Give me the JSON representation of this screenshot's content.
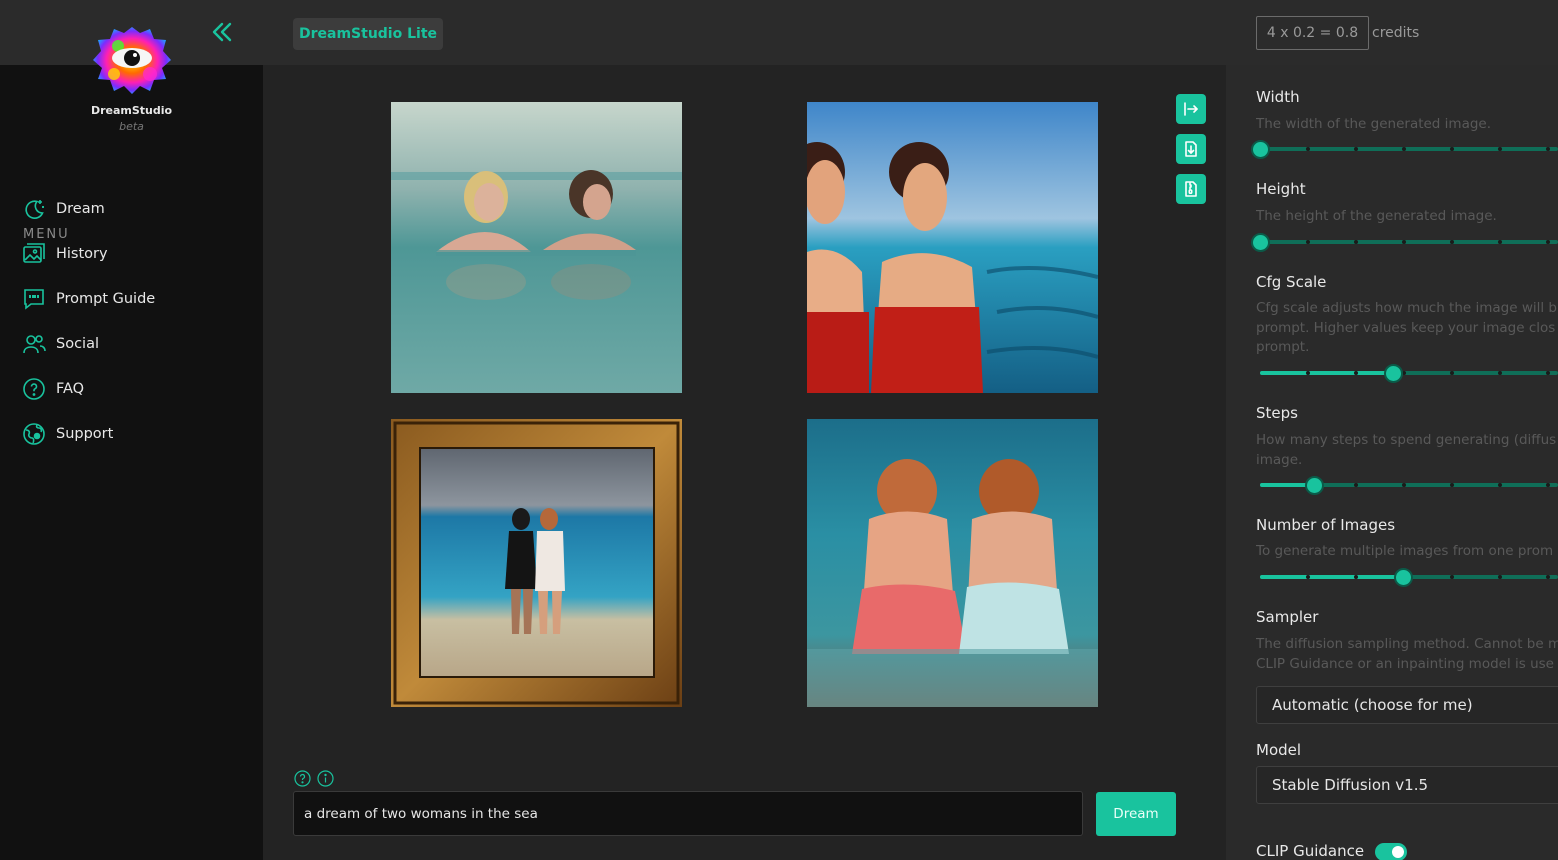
{
  "app": {
    "name": "DreamStudio",
    "beta_label": "beta",
    "mode_tab": "DreamStudio Lite",
    "credits_calc": "4 x 0.2 = 0.8",
    "credits_label": "credits"
  },
  "menu": {
    "heading": "MENU",
    "items": [
      {
        "label": "Dream",
        "icon": "moon-stars-icon"
      },
      {
        "label": "History",
        "icon": "gallery-icon"
      },
      {
        "label": "Prompt Guide",
        "icon": "chat-quote-icon"
      },
      {
        "label": "Social",
        "icon": "users-icon"
      },
      {
        "label": "FAQ",
        "icon": "question-circle-icon"
      },
      {
        "label": "Support",
        "icon": "globe-support-icon"
      }
    ]
  },
  "gallery": {
    "images": [
      {
        "description_icon": "image-two-women-in-sea"
      },
      {
        "description_icon": "image-painted-women-red-dresses"
      },
      {
        "description_icon": "image-framed-women-on-beach"
      },
      {
        "description_icon": "image-women-sitting-in-water"
      }
    ],
    "actions": [
      "use-as-init-icon",
      "download-icon",
      "download-zip-icon"
    ]
  },
  "prompt": {
    "value": "a dream of two womans in the sea",
    "dream_button": "Dream"
  },
  "settings": {
    "width": {
      "title": "Width",
      "desc": "The width of the generated image.",
      "value_fraction": 0.0
    },
    "height": {
      "title": "Height",
      "desc": "The height of the generated image.",
      "value_fraction": 0.0
    },
    "cfg": {
      "title": "Cfg Scale",
      "desc_lines": [
        "Cfg scale adjusts how much the image will b",
        "prompt. Higher values keep your image clos",
        "prompt."
      ],
      "value_fraction": 0.445
    },
    "steps": {
      "title": "Steps",
      "desc_lines": [
        "How many steps to spend generating (diffus",
        "image."
      ],
      "value_fraction": 0.18
    },
    "num_images": {
      "title": "Number of Images",
      "desc": "To generate multiple images from one prom",
      "value_fraction": 0.48
    },
    "sampler": {
      "title": "Sampler",
      "desc_lines": [
        "The diffusion sampling method. Cannot be m",
        "CLIP Guidance or an inpainting model is use"
      ],
      "value": "Automatic (choose for me)"
    },
    "model": {
      "title": "Model",
      "value": "Stable Diffusion v1.5"
    },
    "clip_guidance": {
      "title": "CLIP Guidance",
      "enabled": true
    }
  }
}
